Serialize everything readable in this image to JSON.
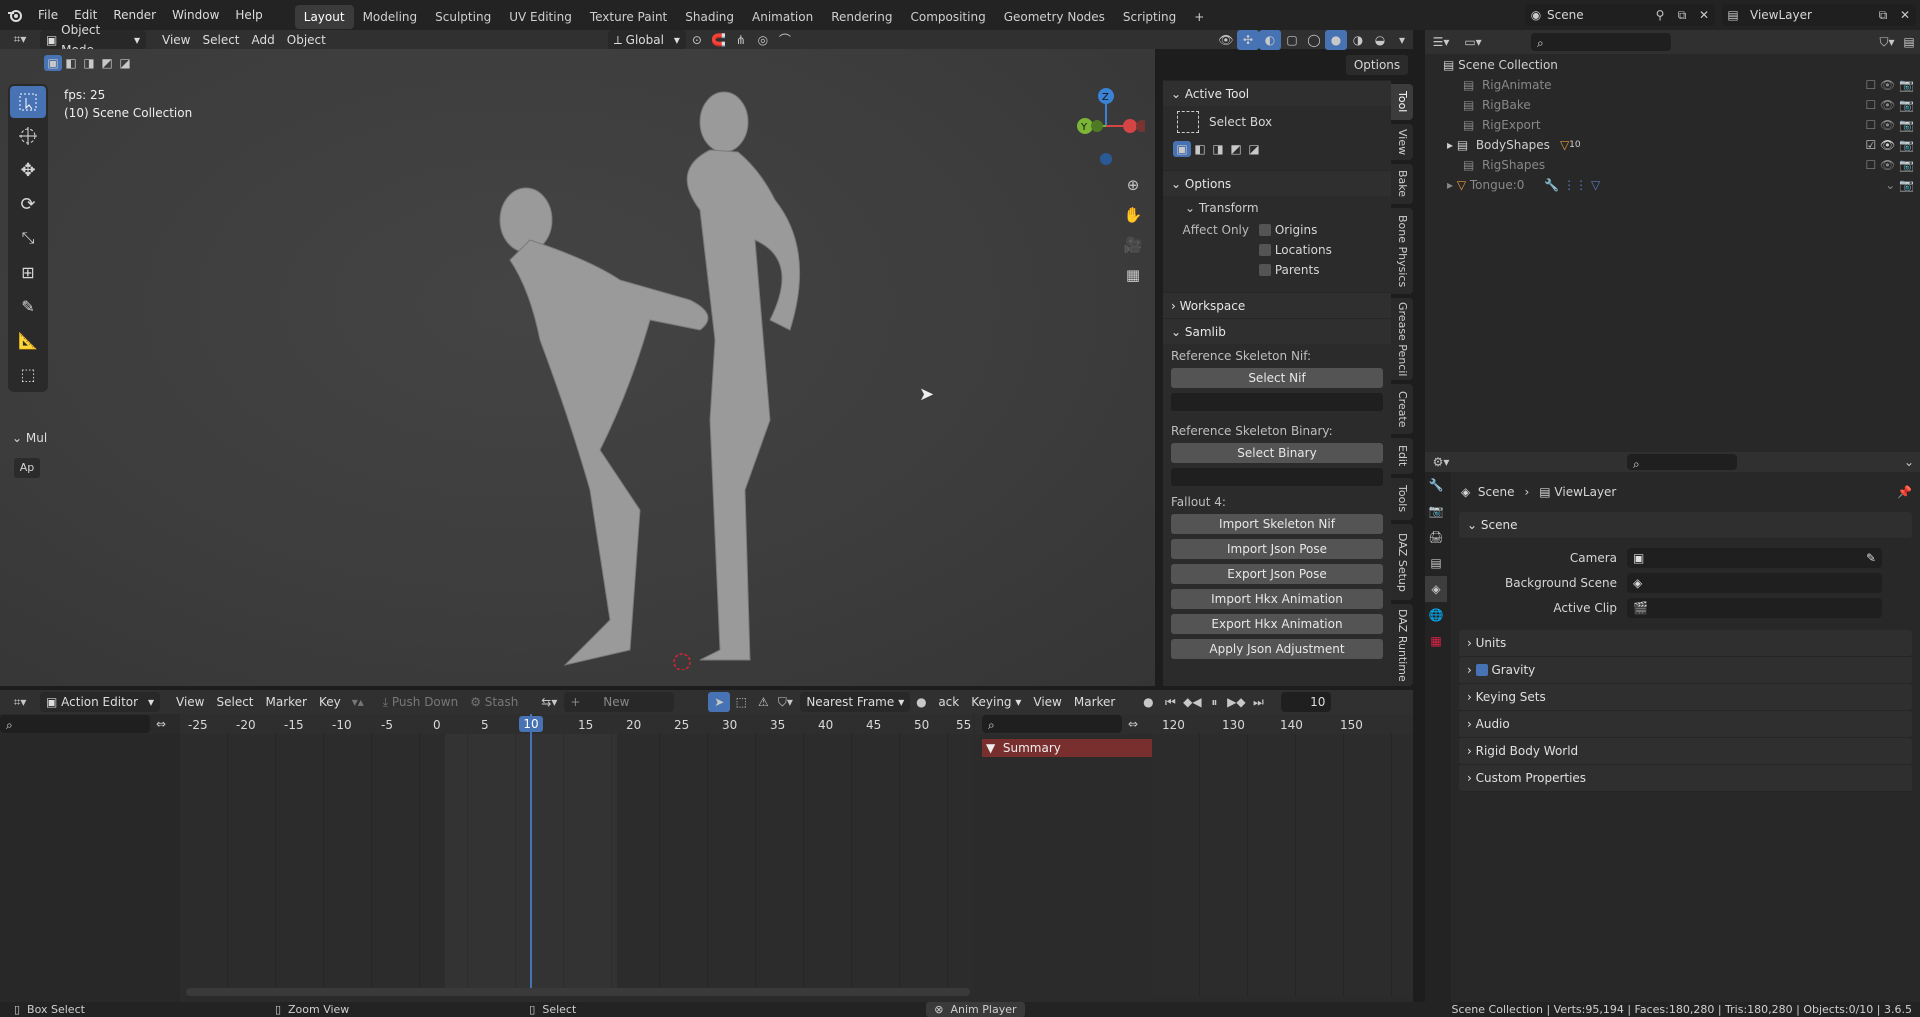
{
  "app": {
    "name": "Blender",
    "version": "3.6.5"
  },
  "topbar": {
    "menus": [
      "File",
      "Edit",
      "Render",
      "Window",
      "Help"
    ],
    "workspaces": [
      "Layout",
      "Modeling",
      "Sculpting",
      "UV Editing",
      "Texture Paint",
      "Shading",
      "Animation",
      "Rendering",
      "Compositing",
      "Geometry Nodes",
      "Scripting"
    ],
    "active_workspace": "Layout",
    "scene": "Scene",
    "view_layer": "ViewLayer"
  },
  "viewport_header": {
    "mode": "Object Mode",
    "menus": [
      "View",
      "Select",
      "Add",
      "Object"
    ],
    "orientation": "Global",
    "options": "Options"
  },
  "overlay": {
    "fps": "fps: 25",
    "collection": "(10) Scene Collection"
  },
  "tool_panel": {
    "collapsed_label": "Mul",
    "apply_label": "Ap"
  },
  "npanel": {
    "active_tool": {
      "title": "Active Tool",
      "tool": "Select Box"
    },
    "options": {
      "title": "Options",
      "transform": "Transform",
      "affect_only": "Affect Only",
      "origins": "Origins",
      "locations": "Locations",
      "parents": "Parents"
    },
    "workspace": "Workspace",
    "samlib": {
      "title": "Samlib",
      "ref_nif_label": "Reference Skeleton Nif:",
      "select_nif": "Select Nif",
      "ref_bin_label": "Reference Skeleton Binary:",
      "select_binary": "Select Binary",
      "fallout": "Fallout 4:",
      "buttons": [
        "Import Skeleton Nif",
        "Import Json Pose",
        "Export Json Pose",
        "Import Hkx Animation",
        "Export Hkx Animation",
        "Apply Json Adjustment"
      ]
    },
    "tabs": [
      "Tool",
      "View",
      "Bake",
      "Bone Physics",
      "Grease Pencil",
      "Create",
      "Edit",
      "Tools",
      "DAZ Setup",
      "DAZ Runtime"
    ]
  },
  "outliner": {
    "root": "Scene Collection",
    "items": [
      {
        "name": "RigAnimate",
        "enabled": false
      },
      {
        "name": "RigBake",
        "enabled": false
      },
      {
        "name": "RigExport",
        "enabled": false
      },
      {
        "name": "BodyShapes",
        "enabled": true,
        "badge": "10"
      },
      {
        "name": "RigShapes",
        "enabled": false
      },
      {
        "name": "Tongue:0",
        "enabled": false
      }
    ]
  },
  "properties": {
    "breadcrumb": [
      "Scene",
      "ViewLayer"
    ],
    "scene_section": "Scene",
    "fields": [
      "Camera",
      "Background Scene",
      "Active Clip"
    ],
    "sections": [
      "Units",
      "Gravity",
      "Keying Sets",
      "Audio",
      "Rigid Body World",
      "Custom Properties"
    ],
    "gravity_checked": true
  },
  "timeline": {
    "editor": "Action Editor",
    "menus": [
      "View",
      "Select",
      "Marker",
      "Key"
    ],
    "push_down": "Push Down",
    "stash": "Stash",
    "new": "New",
    "snap": "Nearest Frame",
    "playback_menus": [
      "Keying",
      "View",
      "Marker"
    ],
    "playback_prefix": "ack",
    "current_frame": "10",
    "ticks_left": [
      "-25",
      "-20",
      "-15",
      "-10",
      "-5",
      "0",
      "5",
      "10",
      "15",
      "20",
      "25",
      "30",
      "35",
      "40",
      "45",
      "50",
      "55"
    ],
    "ticks_right": [
      "120",
      "130",
      "140",
      "150"
    ],
    "summary": "Summary"
  },
  "status": {
    "box_select": "Box Select",
    "zoom_view": "Zoom View",
    "select": "Select",
    "anim_player": "Anim Player",
    "stats": "Scene Collection | Verts:95,194 | Faces:180,280 | Tris:180,280 | Objects:0/10 | 3.6.5"
  }
}
